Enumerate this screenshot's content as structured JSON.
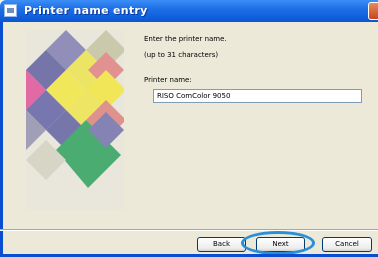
{
  "window": {
    "title": "Printer name entry"
  },
  "content": {
    "instruction_line1": "Enter the printer name.",
    "instruction_line2": "(up to 31 characters)",
    "field_label": "Printer name:",
    "printer_name_value": "RISO ComColor 9050"
  },
  "buttons": {
    "back": "Back",
    "next": "Next",
    "cancel": "Cancel"
  },
  "colors": {
    "titlebar": "#0a56d6",
    "dialog_background": "#ece9d8",
    "highlight_ring": "#2a8fd6"
  }
}
